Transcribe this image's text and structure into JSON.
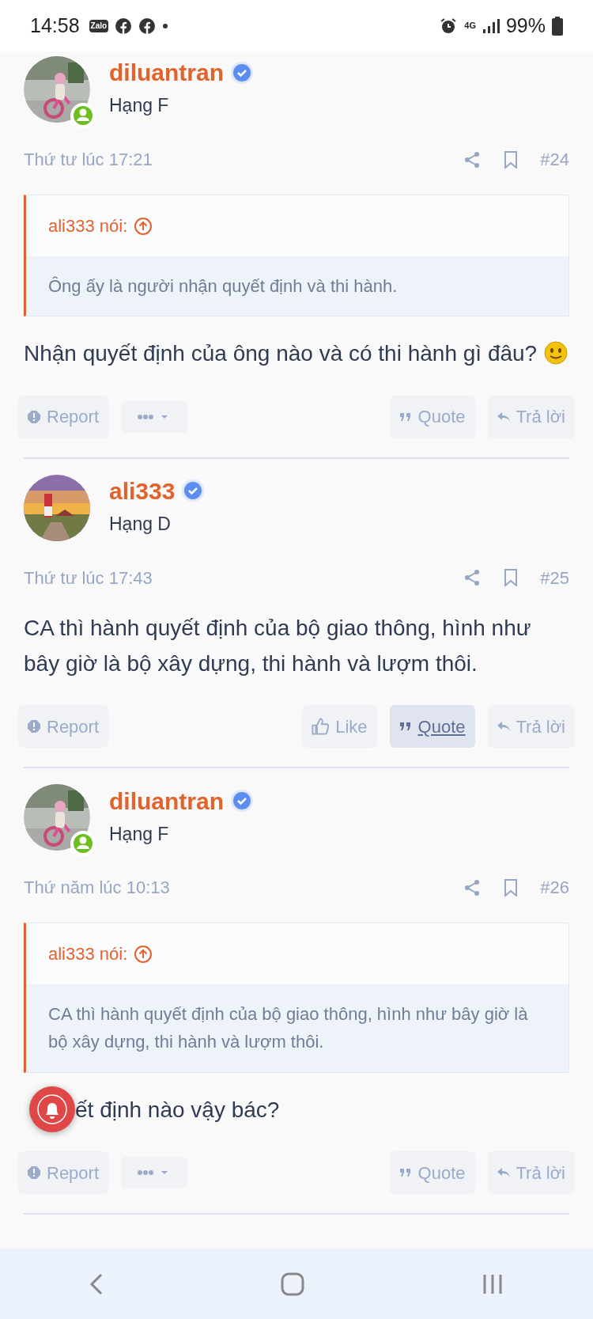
{
  "status_bar": {
    "time": "14:58",
    "zalo_label": "Zalo",
    "network": "4G",
    "battery": "99%"
  },
  "posts": [
    {
      "author": "diluantran",
      "verified": true,
      "online": true,
      "rank": "Hạng F",
      "date": "Thứ tư lúc 17:21",
      "number": "#24",
      "quote": {
        "author": "ali333 nói:",
        "text": "Ông ấy là người nhận quyết định và thi hành."
      },
      "body": "Nhận quyết định của ông nào và có thi hành gì đâu?",
      "smiley": true,
      "bell": false,
      "actions": [
        {
          "kind": "report",
          "label": "Report",
          "selected": false
        },
        {
          "kind": "more",
          "selected": false
        },
        {
          "kind": "quote",
          "label": "Quote",
          "selected": false
        },
        {
          "kind": "reply",
          "label": "Trả lời",
          "selected": false
        }
      ]
    },
    {
      "author": "ali333",
      "verified": true,
      "online": false,
      "rank": "Hạng D",
      "date": "Thứ tư lúc 17:43",
      "number": "#25",
      "body": "CA thì hành quyết định của bộ giao thông, hình như bây giờ là bộ xây dựng, thi hành và lượm thôi.",
      "smiley": false,
      "bell": false,
      "actions": [
        {
          "kind": "report",
          "label": "Report",
          "selected": false
        },
        {
          "kind": "like",
          "label": "Like",
          "selected": false
        },
        {
          "kind": "quote",
          "label": "Quote",
          "selected": true
        },
        {
          "kind": "reply",
          "label": "Trả lời",
          "selected": false
        }
      ]
    },
    {
      "author": "diluantran",
      "verified": true,
      "online": true,
      "rank": "Hạng F",
      "date": "Thứ năm lúc 10:13",
      "number": "#26",
      "quote": {
        "author": "ali333 nói:",
        "text": "CA thì hành quyết định của bộ giao thông, hình như bây giờ là bộ xây dựng, thi hành và lượm thôi."
      },
      "body": "ết định nào vậy bác?",
      "smiley": false,
      "bell": true,
      "actions": [
        {
          "kind": "report",
          "label": "Report",
          "selected": false
        },
        {
          "kind": "more",
          "selected": false
        },
        {
          "kind": "quote",
          "label": "Quote",
          "selected": false
        },
        {
          "kind": "reply",
          "label": "Trả lời",
          "selected": false
        }
      ]
    }
  ]
}
